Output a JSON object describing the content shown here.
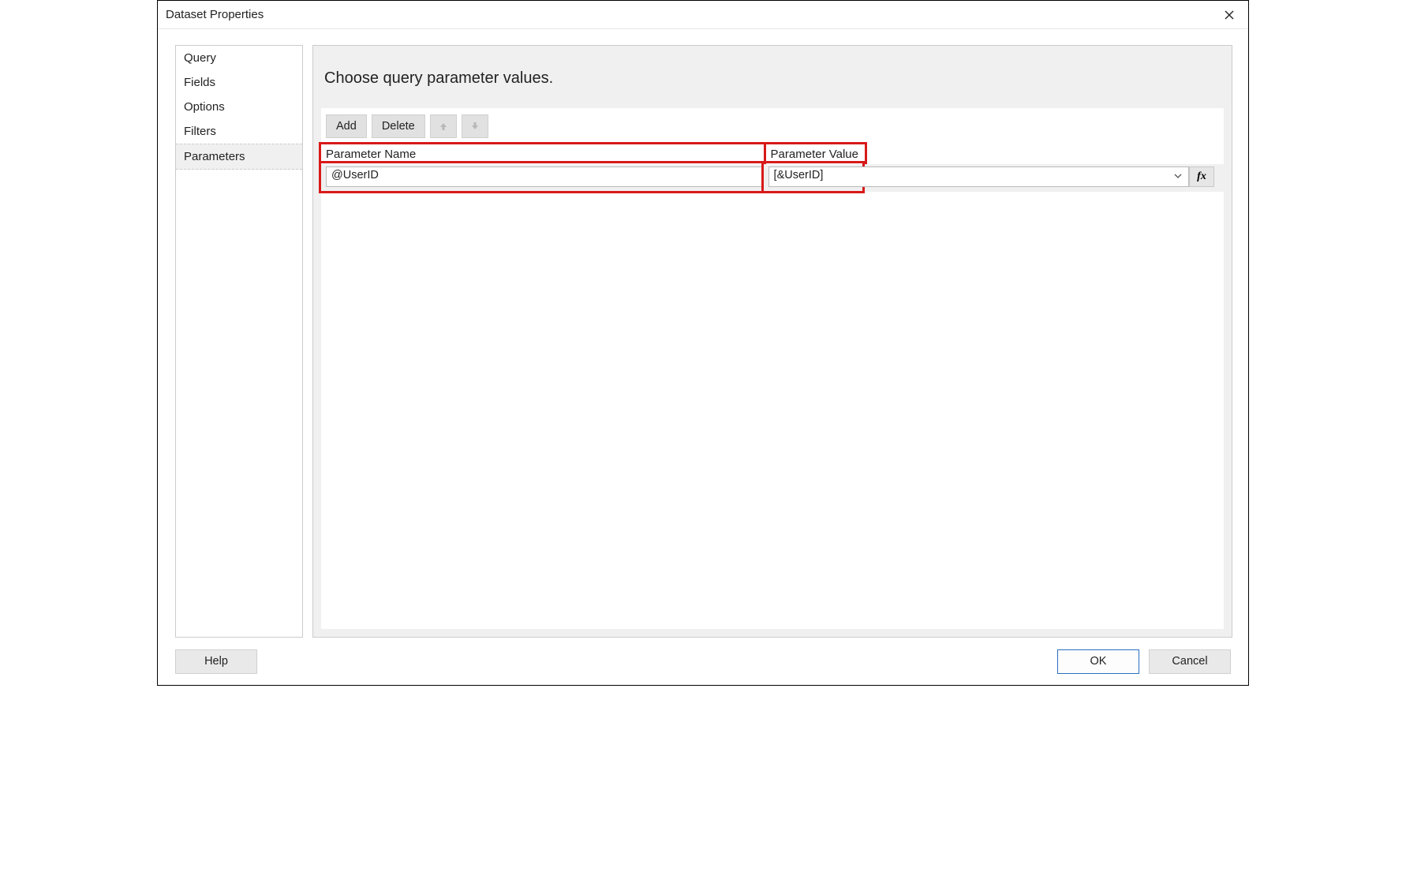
{
  "window": {
    "title": "Dataset Properties"
  },
  "sidebar": {
    "items": [
      {
        "label": "Query"
      },
      {
        "label": "Fields"
      },
      {
        "label": "Options"
      },
      {
        "label": "Filters"
      },
      {
        "label": "Parameters",
        "selected": true
      }
    ]
  },
  "content": {
    "heading": "Choose query parameter values.",
    "toolbar": {
      "add_label": "Add",
      "delete_label": "Delete"
    },
    "grid": {
      "columns": {
        "name_header": "Parameter Name",
        "value_header": "Parameter Value"
      },
      "rows": [
        {
          "name": "@UserID",
          "value": "[&UserID]"
        }
      ]
    }
  },
  "footer": {
    "help_label": "Help",
    "ok_label": "OK",
    "cancel_label": "Cancel"
  },
  "icons": {
    "fx_label": "fx"
  }
}
